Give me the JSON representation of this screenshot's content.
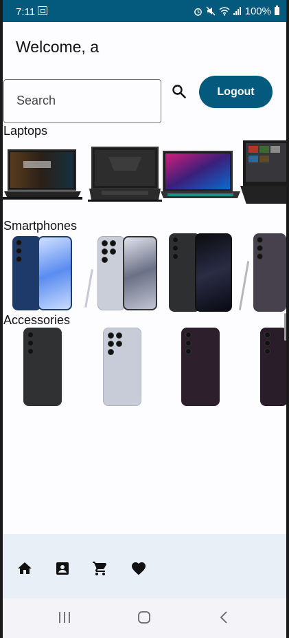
{
  "status_bar": {
    "time": "7:11",
    "battery": "100%"
  },
  "header": {
    "welcome": "Welcome, a"
  },
  "search": {
    "placeholder": "Search"
  },
  "logout": {
    "label": "Logout"
  },
  "sections": [
    {
      "title": "Laptops"
    },
    {
      "title": "Smartphones"
    },
    {
      "title": "Accessories"
    }
  ],
  "nav": [
    {
      "icon": "home-icon"
    },
    {
      "icon": "contact-icon"
    },
    {
      "icon": "cart-icon"
    },
    {
      "icon": "heart-icon"
    }
  ],
  "colors": {
    "primary": "#035a7c",
    "nav_bg": "#e8eff6"
  }
}
